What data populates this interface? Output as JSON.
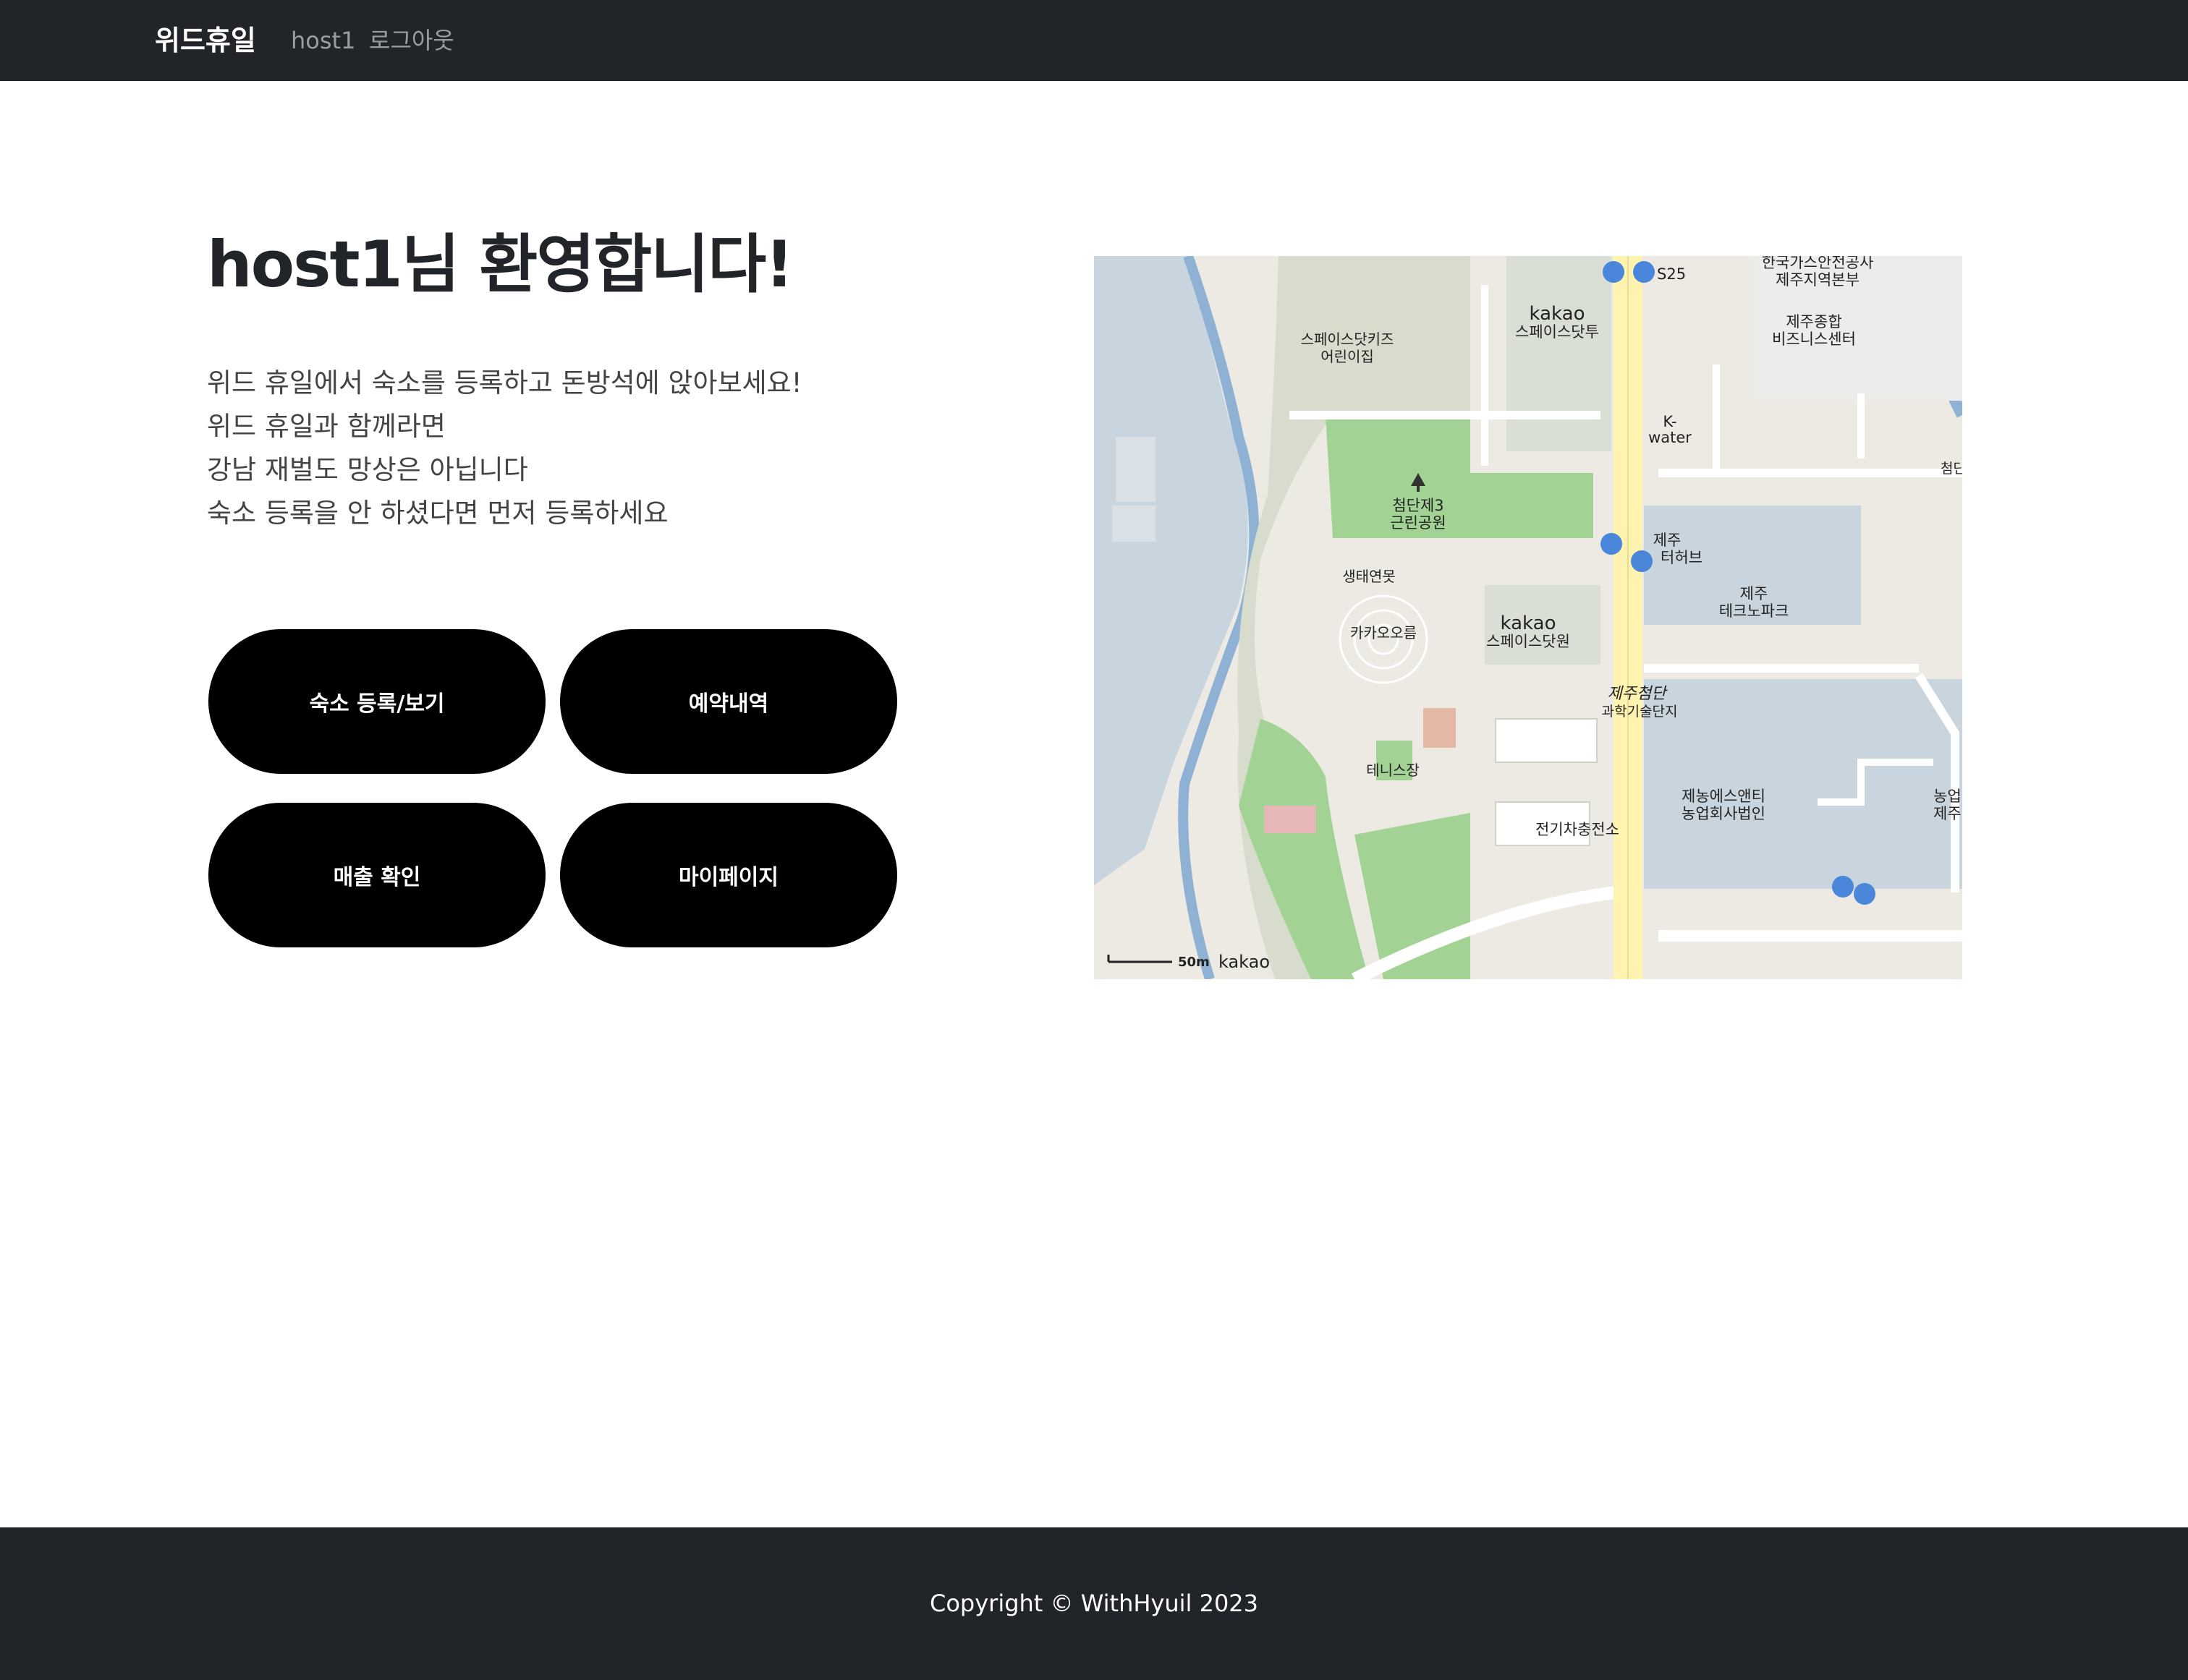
{
  "navbar": {
    "brand": "위드휴일",
    "user": "host1",
    "logout": "로그아웃"
  },
  "main": {
    "title": "host1님 환영합니다!",
    "intro": [
      "위드 휴일에서 숙소를 등록하고 돈방석에 앉아보세요!",
      "위드 휴일과 함께라면",
      "강남 재벌도 망상은 아닙니다",
      "숙소 등록을 안 하셨다면 먼저 등록하세요"
    ],
    "buttons": {
      "register": "숙소 등록/보기",
      "reservations": "예약내역",
      "sales": "매출 확인",
      "mypage": "마이페이지"
    }
  },
  "map": {
    "labels": {
      "space_kids": "스페이스닷키즈",
      "daycare": "어린이집",
      "kakao1": "kakao",
      "kakao1_sub": "스페이스닷투",
      "gas1": "한국가스안전공사",
      "gas2": "제주지역본부",
      "biz1": "제주종합",
      "biz2": "비즈니스센터",
      "kwater1": "K-",
      "kwater2": "water",
      "park1": "첨단제3",
      "park2": "근린공원",
      "hub1": "제주",
      "hub2": "터허브",
      "pond": "생태연못",
      "techno1": "제주",
      "techno2": "테크노파크",
      "oreum": "카카오오름",
      "kakao2": "kakao",
      "kakao2_sub": "스페이스닷원",
      "district1": "제주첨단",
      "district2": "과학기술단지",
      "tennis": "테니스장",
      "ev": "전기차충전소",
      "agri1": "제농에스앤티",
      "agri2": "농업회사법인",
      "edge1": "농업",
      "edge2": "제주",
      "edge3": "첨단",
      "s25": "S25",
      "scale": "50m",
      "logo": "kakao"
    },
    "colors": {
      "land": "#eceae3",
      "park": "#a3d394",
      "water": "#c8d5de",
      "river": "#8fb2d4",
      "road": "#ffffff",
      "main_road": "#fff3b0",
      "bus": "#4a86d9"
    }
  },
  "footer": {
    "copyright": "Copyright © WithHyuil 2023"
  }
}
